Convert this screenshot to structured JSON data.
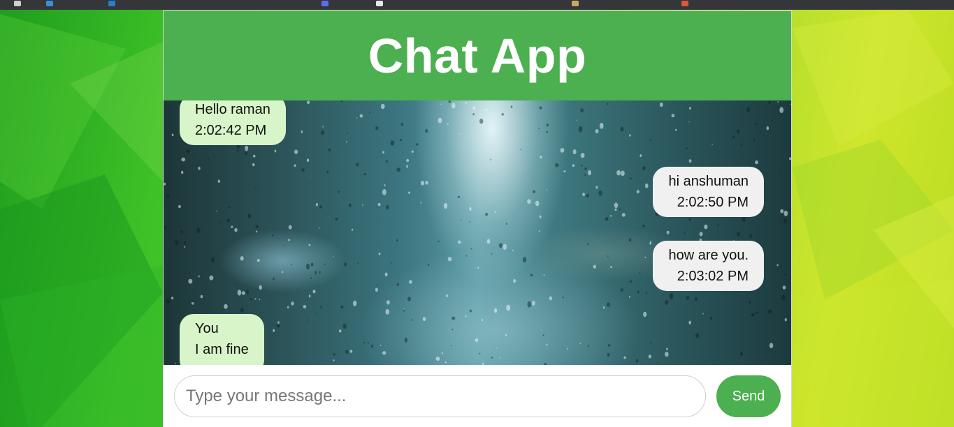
{
  "app": {
    "title": "Chat App"
  },
  "messages": [
    {
      "direction": "incoming",
      "lines": [
        "Hello raman",
        "2:02:42 PM"
      ]
    },
    {
      "direction": "outgoing",
      "lines": [
        "hi anshuman",
        "2:02:50 PM"
      ]
    },
    {
      "direction": "outgoing",
      "lines": [
        "how are you.",
        "2:03:02 PM"
      ]
    },
    {
      "direction": "incoming",
      "lines": [
        "You",
        "I am fine"
      ]
    }
  ],
  "composer": {
    "placeholder": "Type your message...",
    "value": "",
    "send_label": "Send"
  },
  "colors": {
    "header": "#4caf50",
    "send_button": "#4caf50",
    "incoming_bubble": "#d7f5c8",
    "outgoing_bubble": "#f0f0f0",
    "page_background": "#49c42b"
  }
}
